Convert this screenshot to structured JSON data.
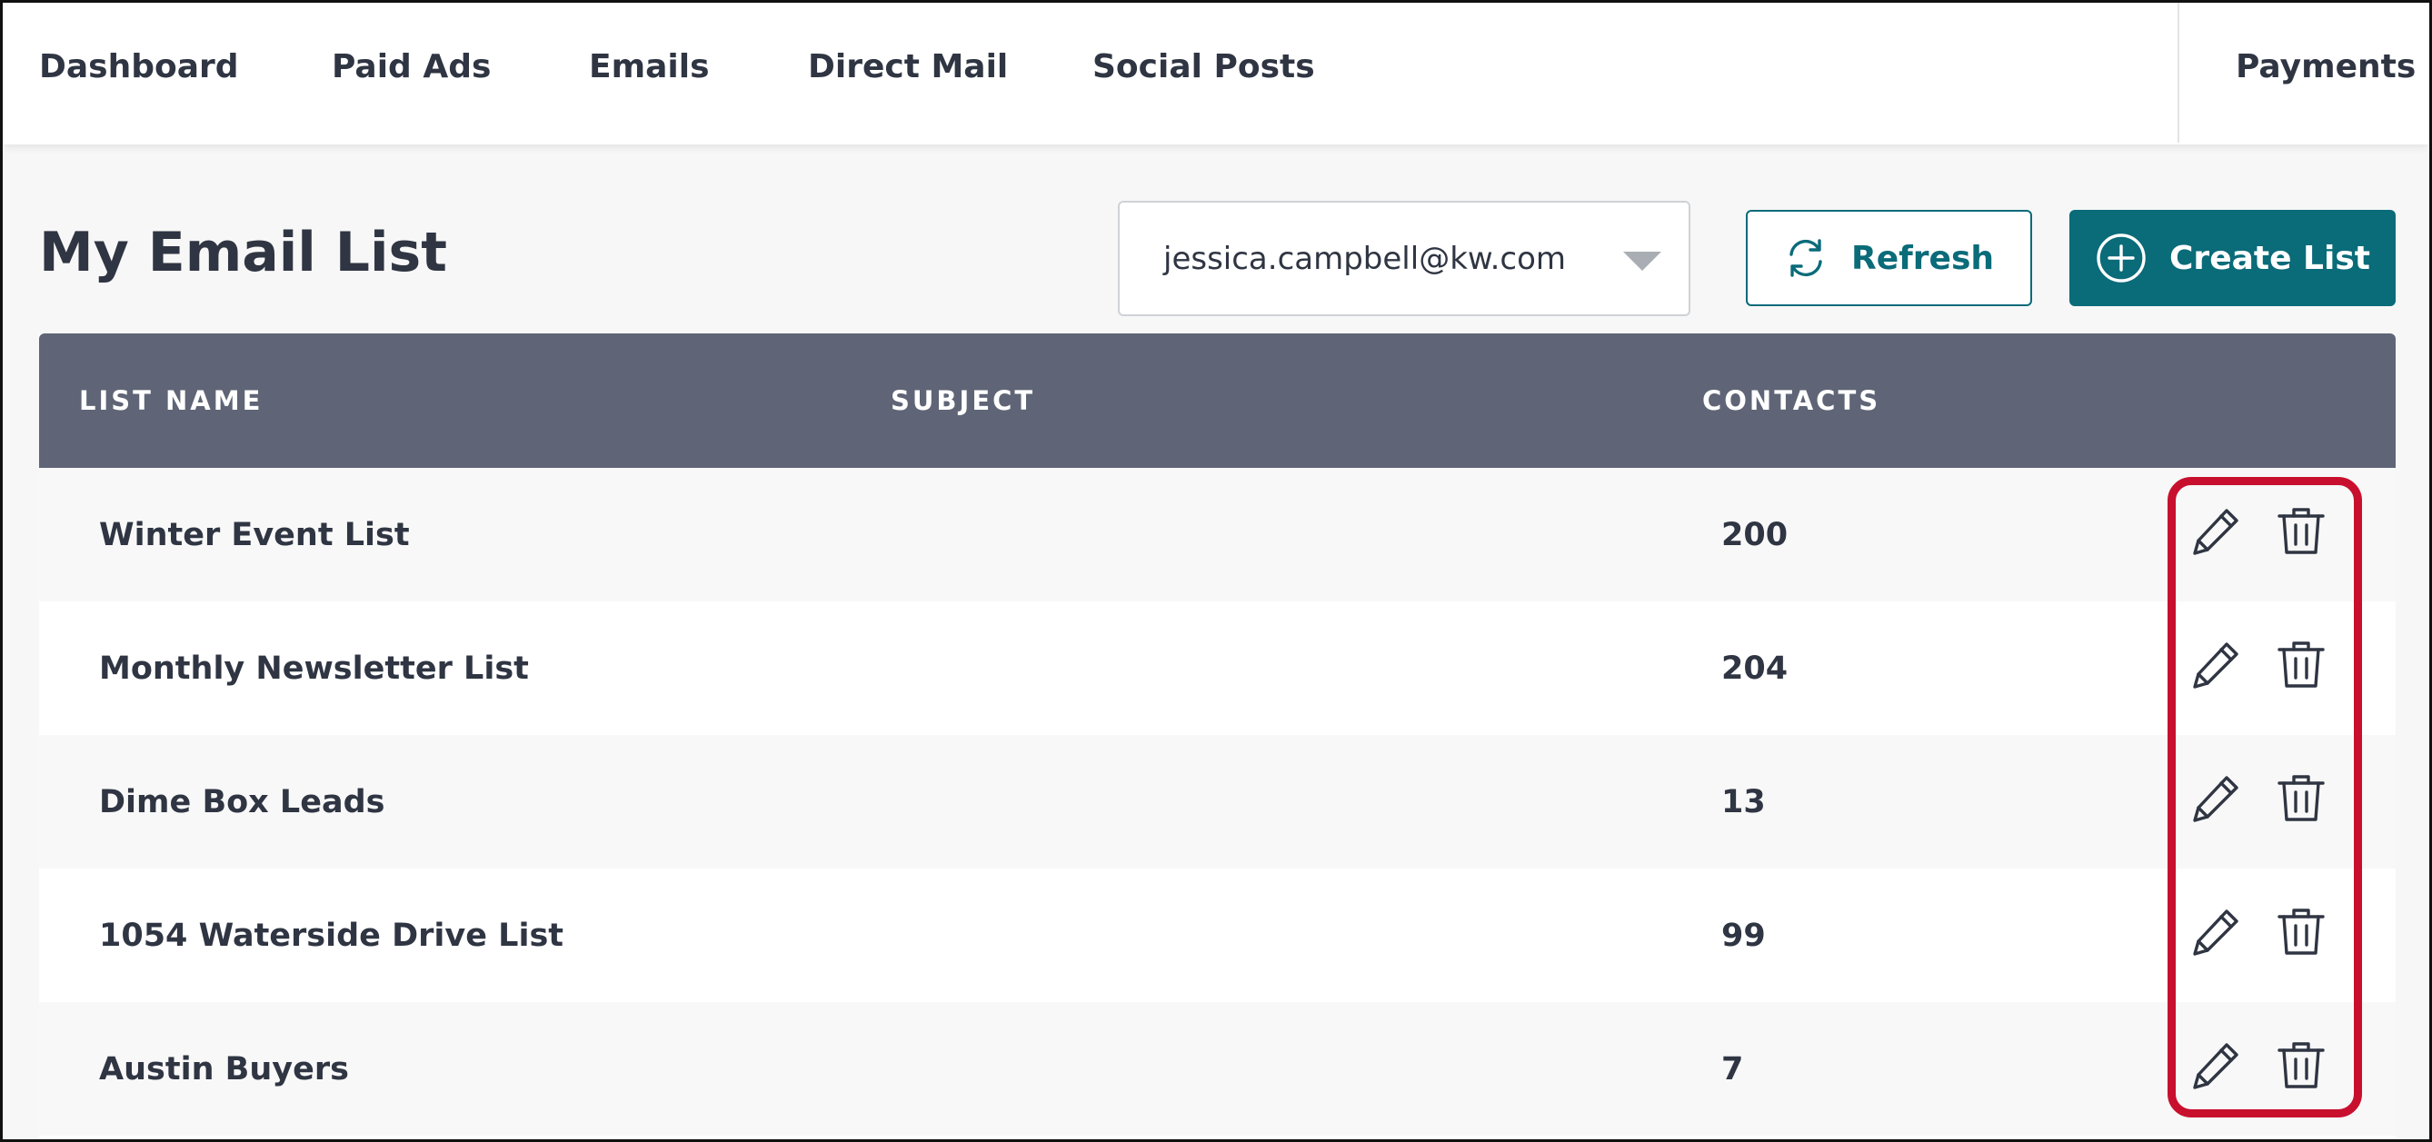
{
  "nav": {
    "items": [
      "Dashboard",
      "Paid Ads",
      "Emails",
      "Direct Mail",
      "Social Posts"
    ],
    "payments": "Payments"
  },
  "page": {
    "title": "My Email List"
  },
  "account_select": {
    "value": "jessica.campbell@kw.com"
  },
  "toolbar": {
    "refresh_label": "Refresh",
    "create_label": "Create List"
  },
  "table": {
    "headers": [
      "LIST NAME",
      "SUBJECT",
      "CONTACTS"
    ],
    "rows": [
      {
        "name": "Winter Event List",
        "subject": "",
        "contacts": "200"
      },
      {
        "name": "Monthly Newsletter List",
        "subject": "",
        "contacts": "204"
      },
      {
        "name": "Dime Box Leads",
        "subject": "",
        "contacts": "13"
      },
      {
        "name": "1054 Waterside Drive List",
        "subject": "",
        "contacts": "99"
      },
      {
        "name": "Austin Buyers",
        "subject": "",
        "contacts": "7"
      }
    ],
    "row_actions": [
      "pencil-icon",
      "trash-icon"
    ]
  },
  "colors": {
    "brand_teal": "#0a6b79",
    "header_slate": "#5f6576",
    "highlight_red": "#c8102e",
    "text_dark": "#2f3542"
  }
}
